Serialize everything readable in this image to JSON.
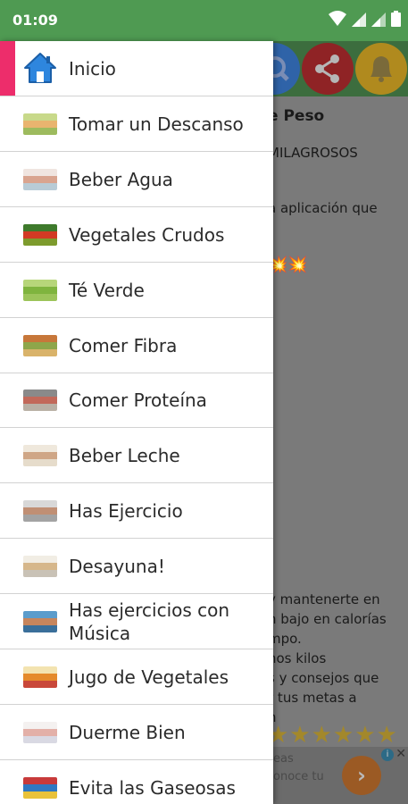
{
  "status_bar": {
    "time": "01:09",
    "icons": [
      "wifi-icon",
      "signal-icon",
      "signal-icon",
      "battery-icon"
    ]
  },
  "background": {
    "toolbar_icons": [
      "search-icon",
      "share-icon",
      "bell-icon"
    ],
    "colors": {
      "toolbar": "#3c6d3e",
      "search": "#2f63a8",
      "share": "#8f2325",
      "bell": "#b08a1e"
    },
    "lines": [
      "e Peso",
      "MILAGROSOS",
      "a aplicación que",
      "y mantenerte en",
      "n bajo en calorías",
      "mpo.",
      "nos kilos",
      "s y consejos que",
      "r tus metas a",
      "n"
    ],
    "emoji_line": "💥💥",
    "stars": "★★★★★★",
    "ad_lines": [
      "eas",
      "onoce tu"
    ],
    "ad_button": "›",
    "ad_info": "i",
    "ad_close": "✕"
  },
  "drawer": {
    "accent": "#ed2d6b",
    "items": [
      {
        "label": "Inicio",
        "icon": "home-icon"
      },
      {
        "label": "Tomar un Descanso",
        "icon": "relax-thumbnail",
        "colors": [
          "#c8d98a",
          "#e9b46f",
          "#9dbb5e"
        ]
      },
      {
        "label": "Beber Agua",
        "icon": "drinking-water-thumbnail",
        "colors": [
          "#f0e5e0",
          "#d9a48f",
          "#b8cbd6"
        ]
      },
      {
        "label": "Vegetales Crudos",
        "icon": "raw-vegetables-thumbnail",
        "colors": [
          "#3e7a2c",
          "#d23a24",
          "#7d9b2d"
        ]
      },
      {
        "label": "Té Verde",
        "icon": "green-tea-thumbnail",
        "colors": [
          "#b7d67a",
          "#7fb43e",
          "#9cc45a"
        ]
      },
      {
        "label": "Comer Fibra",
        "icon": "fiber-food-thumbnail",
        "colors": [
          "#c7773a",
          "#8ea64a",
          "#d9b36a"
        ]
      },
      {
        "label": "Comer Proteína",
        "icon": "protein-food-thumbnail",
        "colors": [
          "#8a8a8a",
          "#c2695a",
          "#b9b0a5"
        ]
      },
      {
        "label": "Beber Leche",
        "icon": "milk-thumbnail",
        "colors": [
          "#efe8dc",
          "#cfa686",
          "#e6dccb"
        ]
      },
      {
        "label": "Has Ejercicio",
        "icon": "exercise-thumbnail",
        "colors": [
          "#d8d8d8",
          "#c08f74",
          "#a3a3a3"
        ]
      },
      {
        "label": "Desayuna!",
        "icon": "breakfast-thumbnail",
        "colors": [
          "#f1ede4",
          "#d6b78b",
          "#c9c2b6"
        ]
      },
      {
        "label": "Has ejercicios con\nMúsica",
        "icon": "music-exercise-thumbnail",
        "colors": [
          "#5b9ccb",
          "#c7855c",
          "#3a6f9a"
        ]
      },
      {
        "label": "Jugo de Vegetales",
        "icon": "vegetable-juice-thumbnail",
        "colors": [
          "#f3e3b0",
          "#e58a2b",
          "#c9483a"
        ]
      },
      {
        "label": "Duerme Bien",
        "icon": "sleep-thumbnail",
        "colors": [
          "#f4f1f0",
          "#e3b0a8",
          "#d9d9e3"
        ]
      },
      {
        "label": "Evita las Gaseosas",
        "icon": "soda-thumbnail",
        "colors": [
          "#c83a3a",
          "#2f78c2",
          "#e9c23a"
        ]
      }
    ]
  }
}
